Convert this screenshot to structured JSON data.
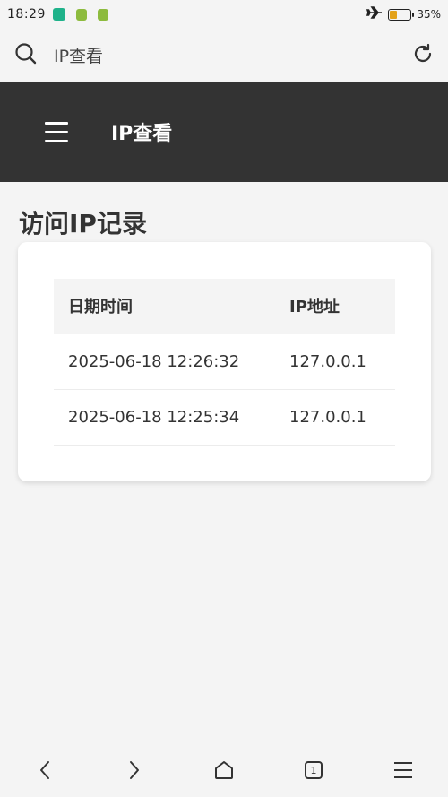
{
  "status_bar": {
    "time": "18:29",
    "battery_text": "35%",
    "battery_level": 0.35,
    "icons": [
      "shield-app-icon",
      "green-app-icon",
      "green-app-icon",
      "airplane-icon",
      "battery-icon"
    ]
  },
  "address_bar": {
    "url": "IP查看",
    "icons": [
      "search-icon",
      "reload-icon"
    ]
  },
  "app_header": {
    "title": "IP查看",
    "menu_icon": "menu-icon",
    "background": "#333333"
  },
  "section": {
    "title": "访问IP记录"
  },
  "table": {
    "headers": [
      "日期时间",
      "IP地址"
    ],
    "rows": [
      [
        "2025-06-18 12:26:32",
        "127.0.0.1"
      ],
      [
        "2025-06-18 12:25:34",
        "127.0.0.1"
      ]
    ]
  },
  "bottom_nav": {
    "tab_count": "1",
    "icons": [
      "back-icon",
      "forward-icon",
      "home-icon",
      "tabs-icon",
      "menu-icon"
    ]
  }
}
